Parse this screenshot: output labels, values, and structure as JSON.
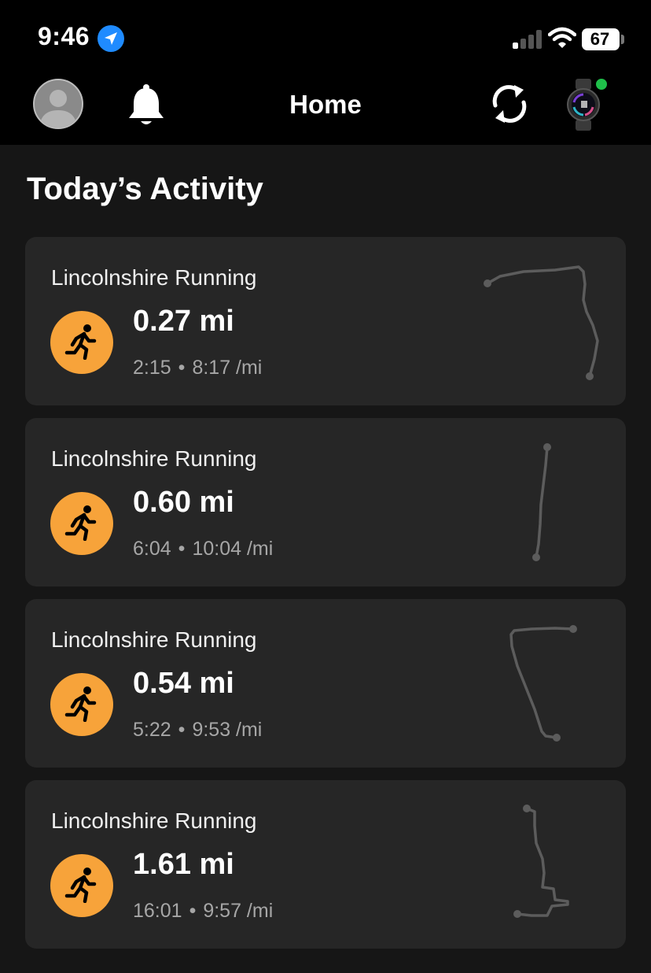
{
  "status_bar": {
    "time": "9:46",
    "battery": "67"
  },
  "nav": {
    "title": "Home"
  },
  "section": {
    "title": "Today’s Activity"
  },
  "activities": [
    {
      "name": "Lincolnshire Running",
      "distance": "0.27 mi",
      "duration": "2:15",
      "pace": "8:17 /mi"
    },
    {
      "name": "Lincolnshire Running",
      "distance": "0.60 mi",
      "duration": "6:04",
      "pace": "10:04 /mi"
    },
    {
      "name": "Lincolnshire Running",
      "distance": "0.54 mi",
      "duration": "5:22",
      "pace": "9:53 /mi"
    },
    {
      "name": "Lincolnshire Running",
      "distance": "1.61 mi",
      "duration": "16:01",
      "pace": "9:57 /mi"
    }
  ],
  "icons": {
    "location": "location-arrow-icon",
    "signal": "cellular-signal-icon",
    "wifi": "wifi-icon",
    "battery": "battery-icon",
    "avatar": "avatar-icon",
    "bell": "bell-icon",
    "sync": "sync-icon",
    "watch": "watch-icon",
    "activity": "running-icon",
    "route": "route-map-icon"
  },
  "colors": {
    "background": "#161616",
    "card": "#262626",
    "accent": "#f7a33a",
    "connected": "#1fbf4a",
    "location": "#1f8bff"
  }
}
